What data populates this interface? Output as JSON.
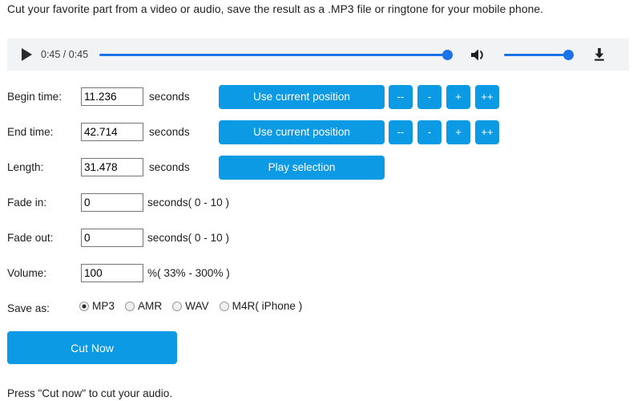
{
  "intro": "Cut your favorite part from a video or audio, save the result as a .MP3 file or ringtone for your mobile phone.",
  "player": {
    "play_icon": "play-icon",
    "time_display": "0:45 / 0:45",
    "current_time": "0:45",
    "duration": "0:45",
    "progress_percent": 100,
    "volume_percent": 100,
    "speaker_icon": "speaker-icon",
    "download_icon": "download-icon",
    "accent_color": "#1a73e8",
    "bar_background": "#f1f3f4"
  },
  "form": {
    "button_color": "#0d9ae5",
    "rows": [
      {
        "label": "Begin time:",
        "value": "11.236",
        "unit": "seconds",
        "main_button": "Use current position",
        "mini_buttons": [
          "--",
          "-",
          "+",
          "++"
        ]
      },
      {
        "label": "End time:",
        "value": "42.714",
        "unit": "seconds",
        "main_button": "Use current position",
        "mini_buttons": [
          "--",
          "-",
          "+",
          "++"
        ]
      },
      {
        "label": "Length:",
        "value": "31.478",
        "unit": "seconds",
        "main_button": "Play selection"
      },
      {
        "label": "Fade in:",
        "value": "0",
        "unit": "seconds( 0 - 10 )"
      },
      {
        "label": "Fade out:",
        "value": "0",
        "unit": "seconds( 0 - 10 )"
      },
      {
        "label": "Volume:",
        "value": "100",
        "unit": "%( 33% - 300% )"
      }
    ],
    "save_as": {
      "label": "Save as:",
      "options": [
        {
          "label": "MP3",
          "selected": true
        },
        {
          "label": "AMR",
          "selected": false
        },
        {
          "label": "WAV",
          "selected": false
        },
        {
          "label": "M4R( iPhone )",
          "selected": false
        }
      ]
    },
    "cut_button": "Cut Now"
  },
  "footer": "Press \"Cut now\" to cut your audio."
}
